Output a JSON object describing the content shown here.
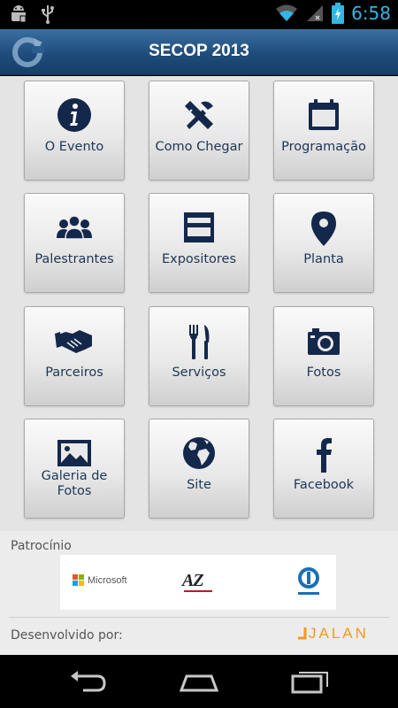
{
  "header": {
    "title": "SECOP 2013"
  },
  "status_bar": {
    "time": "6:58",
    "accent": "#33b5e5"
  },
  "menu": {
    "accent_color": "#14284b",
    "items": [
      {
        "label": "O Evento",
        "icon": "info-icon"
      },
      {
        "label": "Como Chegar",
        "icon": "tools-icon"
      },
      {
        "label": "Programação",
        "icon": "calendar-icon"
      },
      {
        "label": "Palestrantes",
        "icon": "people-icon"
      },
      {
        "label": "Expositores",
        "icon": "booth-icon"
      },
      {
        "label": "Planta",
        "icon": "map-pin-icon"
      },
      {
        "label": "Parceiros",
        "icon": "handshake-icon"
      },
      {
        "label": "Serviços",
        "icon": "fork-knife-icon"
      },
      {
        "label": "Fotos",
        "icon": "camera-icon"
      },
      {
        "label": "Galeria de Fotos",
        "icon": "picture-icon"
      },
      {
        "label": "Site",
        "icon": "globe-icon"
      },
      {
        "label": "Facebook",
        "icon": "facebook-icon"
      }
    ]
  },
  "sponsors": {
    "title": "Patrocínio",
    "logos": [
      {
        "name": "Microsoft",
        "icon": "microsoft-logo"
      },
      {
        "name": "AZ",
        "icon": "az-logo"
      },
      {
        "name": "",
        "icon": "sponsor-circle-logo"
      }
    ]
  },
  "developer": {
    "label": "Desenvolvido por:",
    "brand": "JALAN",
    "brand_color": "#f39a1e"
  }
}
